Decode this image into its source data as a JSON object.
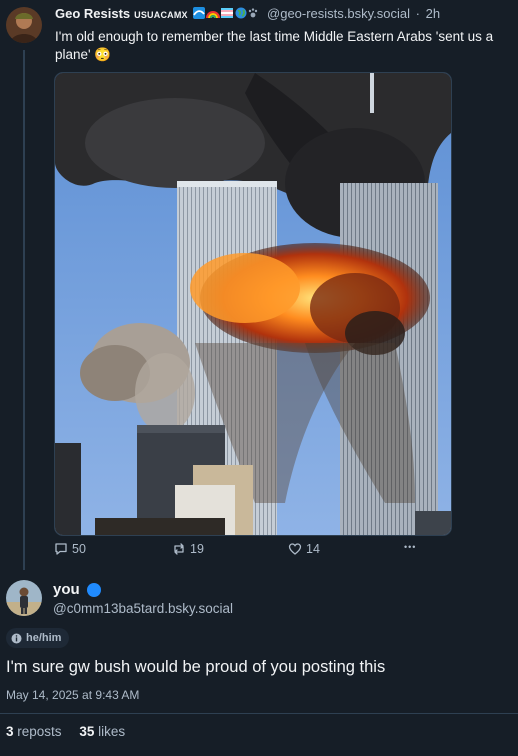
{
  "post": {
    "author": "Geo Resists",
    "tag": "USUACAMX",
    "emoji_icons": [
      "wave-emoji",
      "rainbow-emoji",
      "trans-flag-emoji",
      "globe-emoji",
      "paw-emoji"
    ],
    "handle": "@geo-resists.bsky.social",
    "separator": "·",
    "time": "2h",
    "text": "I'm old enough to remember the last time Middle Eastern Arabs 'sent us a plane' 😳",
    "image_icon": "twin-towers-explosion-photo",
    "actions": {
      "replies": "50",
      "reposts": "19",
      "likes": "14",
      "more": "•••"
    }
  },
  "reply": {
    "author": "you",
    "handle": "@c0mm13ba5tard.bsky.social",
    "pronouns": "he/him",
    "text": "I'm sure gw bush would be proud of you posting this",
    "timestamp": "May 14, 2025 at 9:43 AM",
    "reposts_count": "3",
    "reposts_label": "reposts",
    "likes_count": "35",
    "likes_label": "likes"
  },
  "colors": {
    "background": "#161e27",
    "text": "#f1f3f5",
    "muted": "#aebbc9",
    "divider": "#2e4052",
    "verified": "#208bfe"
  }
}
